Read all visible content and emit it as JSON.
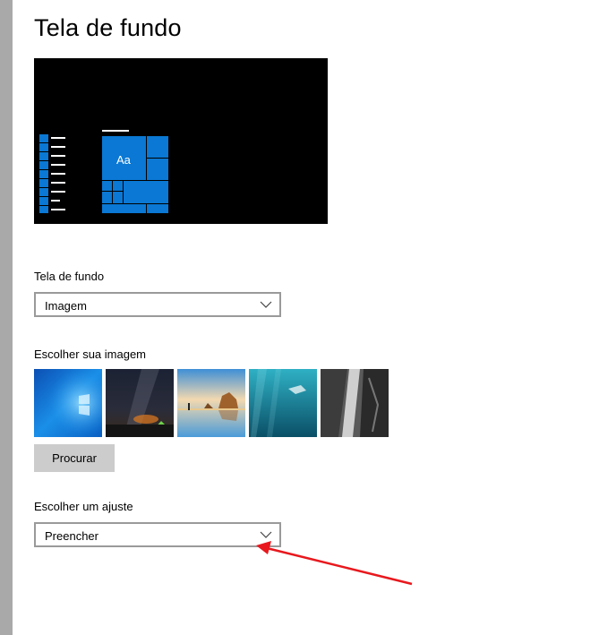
{
  "page": {
    "title": "Tela de fundo"
  },
  "preview": {
    "sample_text": "Aa"
  },
  "background_section": {
    "label": "Tela de fundo",
    "selected": "Imagem"
  },
  "image_section": {
    "label": "Escolher sua imagem",
    "thumbnails": [
      {
        "name": "windows-blue-light"
      },
      {
        "name": "night-sky-tent"
      },
      {
        "name": "beach-rock-arch"
      },
      {
        "name": "underwater-swimmer"
      },
      {
        "name": "rock-waterfall"
      }
    ],
    "browse_label": "Procurar"
  },
  "fit_section": {
    "label": "Escolher um ajuste",
    "selected": "Preencher"
  },
  "colors": {
    "accent": "#0a78d4",
    "annotation": "#e8181d",
    "sidebar_strip": "#a9a9a9",
    "button_bg": "#cccccc"
  },
  "icons": {
    "dropdown": "chevron-down-icon"
  }
}
